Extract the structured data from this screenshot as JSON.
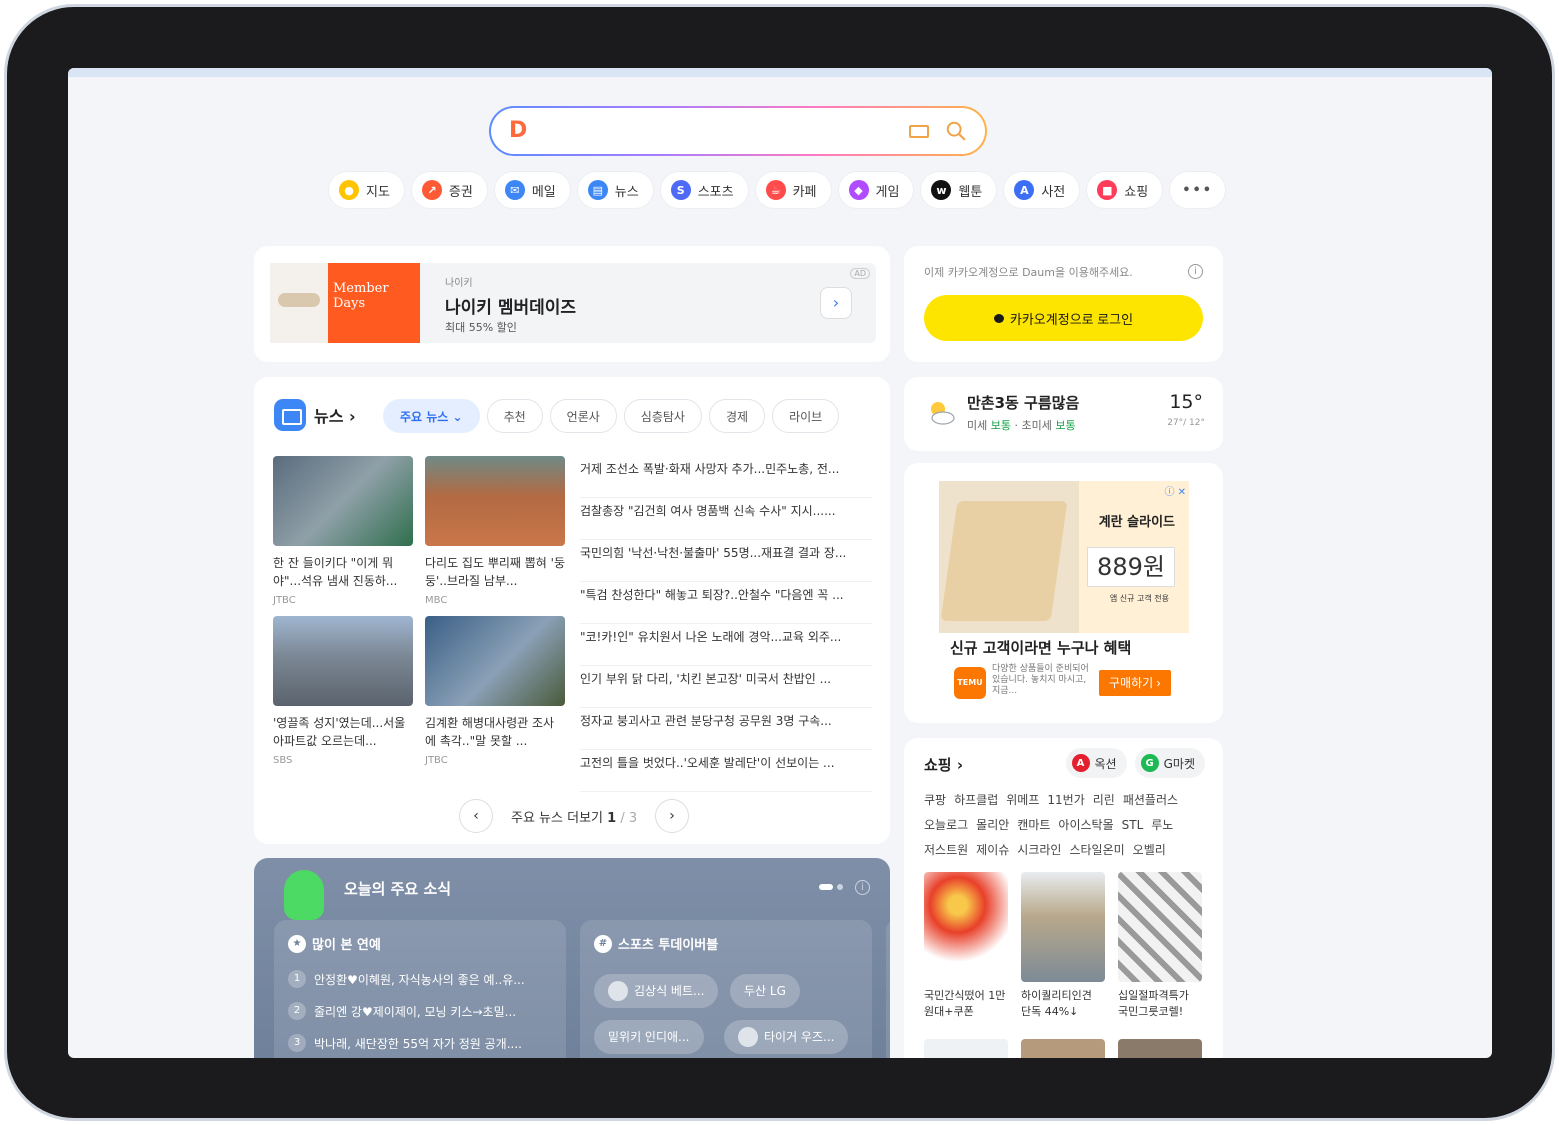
{
  "search": {
    "logo": "D",
    "placeholder": ""
  },
  "services": [
    {
      "label": "지도",
      "icon": "map-pin-icon",
      "color": "#ffc400"
    },
    {
      "label": "증권",
      "icon": "stock-chart-icon",
      "color": "#ff5a36"
    },
    {
      "label": "메일",
      "icon": "mail-icon",
      "color": "#3d86f5"
    },
    {
      "label": "뉴스",
      "icon": "news-icon",
      "color": "#3d86f5"
    },
    {
      "label": "스포츠",
      "icon": "sports-icon",
      "color": "#4d6bf6"
    },
    {
      "label": "카페",
      "icon": "cafe-icon",
      "color": "#ff4b4b"
    },
    {
      "label": "게임",
      "icon": "game-icon",
      "color": "#b04bff"
    },
    {
      "label": "웹툰",
      "icon": "webtoon-icon",
      "color": "#111111"
    },
    {
      "label": "사전",
      "icon": "dictionary-icon",
      "color": "#3d6ff5"
    },
    {
      "label": "쇼핑",
      "icon": "shopping-icon",
      "color": "#ff3d5a"
    }
  ],
  "services_more": "•••",
  "ad": {
    "banner_line1": "Member",
    "banner_line2": "Days",
    "brand": "나이키",
    "title": "나이키 멤버데이즈",
    "subtitle": "최대 55% 할인",
    "badge": "AD"
  },
  "login": {
    "note": "이제 카카오계정으로 Daum을 이용해주세요.",
    "button": "카카오계정으로 로그인"
  },
  "news": {
    "title": "뉴스 ›",
    "tabs": [
      "주요 뉴스 ⌄",
      "추천",
      "언론사",
      "심층탐사",
      "경제",
      "라이브"
    ],
    "thumbs": [
      {
        "caption": "한 잔 들이키다 \"이게 뭐야\"...석유 냄새 진동하...",
        "source": "JTBC"
      },
      {
        "caption": "다리도 집도 뿌리째 뽑혀 '둥둥'..브라질 남부...",
        "source": "MBC"
      },
      {
        "caption": "'영끌족 성지'였는데...서울 아파트값 오르는데...",
        "source": "SBS"
      },
      {
        "caption": "김계환 해병대사령관 조사에 촉각..\"말 못할 ...",
        "source": "JTBC"
      }
    ],
    "headlines": [
      "거제 조선소 폭발·화재 사망자 추가...민주노총, 전...",
      "검찰총장 \"김건희 여사 명품백 신속 수사\" 지시......",
      "국민의힘 '낙선·낙천·불출마' 55명...재표결 결과 장...",
      "\"특검 찬성한다\" 해놓고 퇴장?..안철수 \"다음엔 꼭 ...",
      "\"코!카!인\" 유치원서 나온 노래에 경악...교육 외주...",
      "인기 부위 닭 다리, '치킨 본고장' 미국서 찬밥인 ...",
      "정자교 붕괴사고 관련 분당구청 공무원 3명 구속...",
      "고전의 틀을 벗었다..'오세훈 발레단'이 선보이는 ..."
    ],
    "more_label": "주요 뉴스 더보기",
    "page_current": "1",
    "page_total": " / 3"
  },
  "weather": {
    "location": "만촌3동 구름많음",
    "fine_dust_label": "미세",
    "fine_dust_value": "보통",
    "ultra_dust_label": "초미세",
    "ultra_dust_value": "보통",
    "temp": "15°",
    "range": "27°/ 12°"
  },
  "promo": {
    "banner_title": "계란 슬라이드",
    "price": "889원",
    "price_note": "앱 신규 고객 전용",
    "headline": "신규 고객이라면 누구나 혜택",
    "brand": "TEMU",
    "desc": "다양한 상품들이 준비되어 있습니다. 놓치지 마시고, 지금...",
    "button": "구매하기 ›",
    "ad_mark": "ⓘ ✕"
  },
  "shopping": {
    "title": "쇼핑 ›",
    "buttons": [
      {
        "label": "옥션",
        "mark": "A",
        "color": "#e5202e"
      },
      {
        "label": "G마켓",
        "mark": "G",
        "color": "#1db954"
      }
    ],
    "malls": [
      "쿠팡",
      "하프클럽",
      "위메프",
      "11번가",
      "리린",
      "패션플러스",
      "오늘로그",
      "몰리안",
      "캔마트",
      "아이스탁몰",
      "STL",
      "루노",
      "저스트원",
      "제이슈",
      "시크라인",
      "스타일온미",
      "오벨리"
    ],
    "products": [
      {
        "caption": "국민간식떴어 1만원대+쿠폰"
      },
      {
        "caption": "하이퀄리티인견 단독 44%↓"
      },
      {
        "caption": "십일절파격특가 국민그릇코렐!"
      }
    ]
  },
  "today": {
    "title": "오늘의 주요 소식",
    "popular_title": "많이 본 연예",
    "popular": [
      {
        "n": "1",
        "text": "안정환♥이혜원, 자식농사의 좋은 예..유..."
      },
      {
        "n": "2",
        "text": "줄리엔 강♥제이제이, 모닝 키스→초밀..."
      },
      {
        "n": "3",
        "text": "박나래, 새단장한 55억 자가 정원 공개...."
      }
    ],
    "sports_title": "스포츠 투데이버블",
    "chips": [
      "김상식 베트...",
      "두산 LG",
      "밑위키 인디애...",
      "타이거 우즈..."
    ]
  }
}
